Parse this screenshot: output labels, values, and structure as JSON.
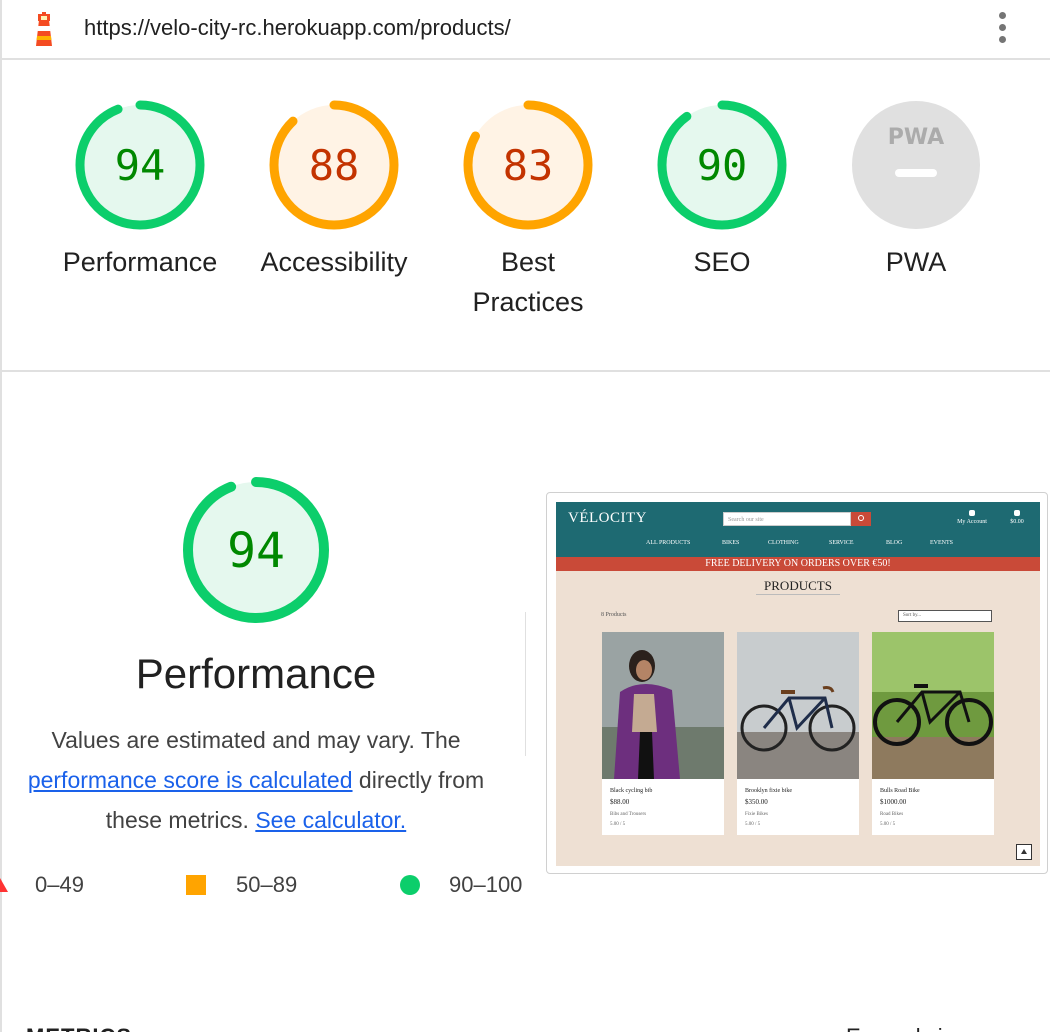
{
  "header": {
    "url": "https://velo-city-rc.herokuapp.com/products/"
  },
  "colors": {
    "pass": "#0cce6b",
    "pass_text": "#008800",
    "pass_fill": "#e5f8ee",
    "average": "#ffa400",
    "average_text": "#c33300",
    "average_fill": "#fff3e5",
    "fail": "#ff3333",
    "na": "#e0e0e0",
    "link": "#1a61ea"
  },
  "scores": [
    {
      "label": "Performance",
      "score": 94,
      "status": "pass"
    },
    {
      "label": "Accessibility",
      "score": 88,
      "status": "average"
    },
    {
      "label": "Best Practices",
      "score": 83,
      "status": "average"
    },
    {
      "label": "SEO",
      "score": 90,
      "status": "pass"
    },
    {
      "label": "PWA",
      "score": null,
      "status": "na",
      "badge": "PWA"
    }
  ],
  "performance": {
    "score": 94,
    "title": "Performance",
    "desc_prefix": "Values are estimated and may vary. The",
    "link_calc": "performance score is calculated",
    "desc_mid": "directly from these metrics.",
    "link_calculator": "See calculator."
  },
  "legend": [
    {
      "icon": "triangle-icon",
      "range": "0–49"
    },
    {
      "icon": "square-icon",
      "range": "50–89"
    },
    {
      "icon": "circle-icon",
      "range": "90–100"
    }
  ],
  "screenshot": {
    "logo": "VÉLOCITY",
    "search_placeholder": "Search our site",
    "account": "My Account",
    "cart": "$0.00",
    "nav": [
      "ALL PRODUCTS",
      "BIKES",
      "CLOTHING",
      "SERVICE",
      "BLOG",
      "EVENTS"
    ],
    "banner": "FREE DELIVERY ON ORDERS OVER €50!",
    "title": "PRODUCTS",
    "count": "8 Products",
    "sort": "Sort by...",
    "products": [
      {
        "name": "Black cycling bib",
        "price": "$88.00",
        "category": "Bibs and Trousers",
        "rating": "5.00 / 5"
      },
      {
        "name": "Brooklyn fixie bike",
        "price": "$350.00",
        "category": "Fixie Bikes",
        "rating": "5.00 / 5"
      },
      {
        "name": "Bulls Road Bike",
        "price": "$1000.00",
        "category": "Road Bikes",
        "rating": "5.00 / 5"
      }
    ]
  },
  "bottom": {
    "metrics": "METRICS",
    "expand": "Expand view"
  }
}
